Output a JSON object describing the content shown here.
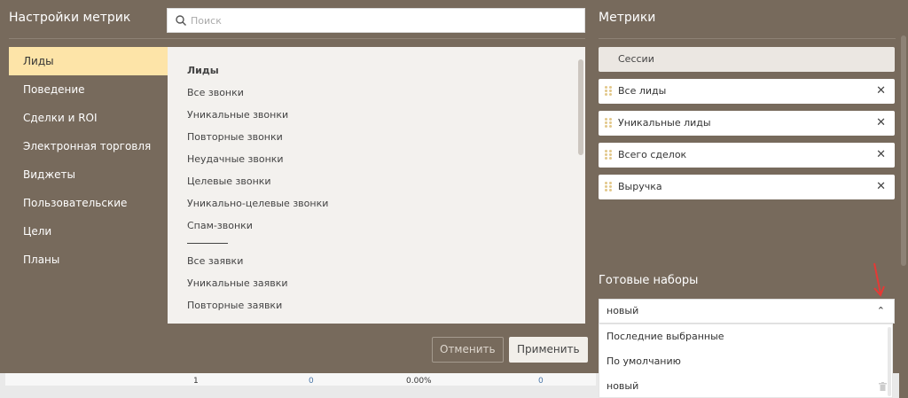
{
  "left": {
    "title": "Настройки метрик",
    "search_placeholder": "Поиск",
    "categories": [
      {
        "label": "Лиды",
        "active": true
      },
      {
        "label": "Поведение"
      },
      {
        "label": "Сделки и ROI"
      },
      {
        "label": "Электронная торговля"
      },
      {
        "label": "Виджеты"
      },
      {
        "label": "Пользовательские"
      },
      {
        "label": "Цели"
      },
      {
        "label": "Планы"
      }
    ]
  },
  "metrics_list": {
    "heading": "Лиды",
    "items": [
      "Все звонки",
      "Уникальные звонки",
      "Повторные звонки",
      "Неудачные звонки",
      "Целевые звонки",
      "Уникально-целевые звонки",
      "Спам-звонки",
      "Все заявки",
      "Уникальные заявки",
      "Повторные заявки"
    ]
  },
  "buttons": {
    "cancel": "Отменить",
    "apply": "Применить"
  },
  "right": {
    "title": "Метрики",
    "session_label": "Сессии",
    "selected": [
      "Все лиды",
      "Уникальные лиды",
      "Всего сделок",
      "Выручка"
    ],
    "presets_title": "Готовые наборы",
    "preset_value": "новый",
    "preset_options": [
      "Последние выбранные",
      "По умолчанию",
      "новый"
    ]
  },
  "background_row": {
    "values": [
      "1",
      "0",
      "0.00%",
      "0"
    ]
  },
  "colors": {
    "panel_bg": "#776a5c",
    "active_category": "#fde4a8",
    "annotation_arrow": "#e53935"
  }
}
